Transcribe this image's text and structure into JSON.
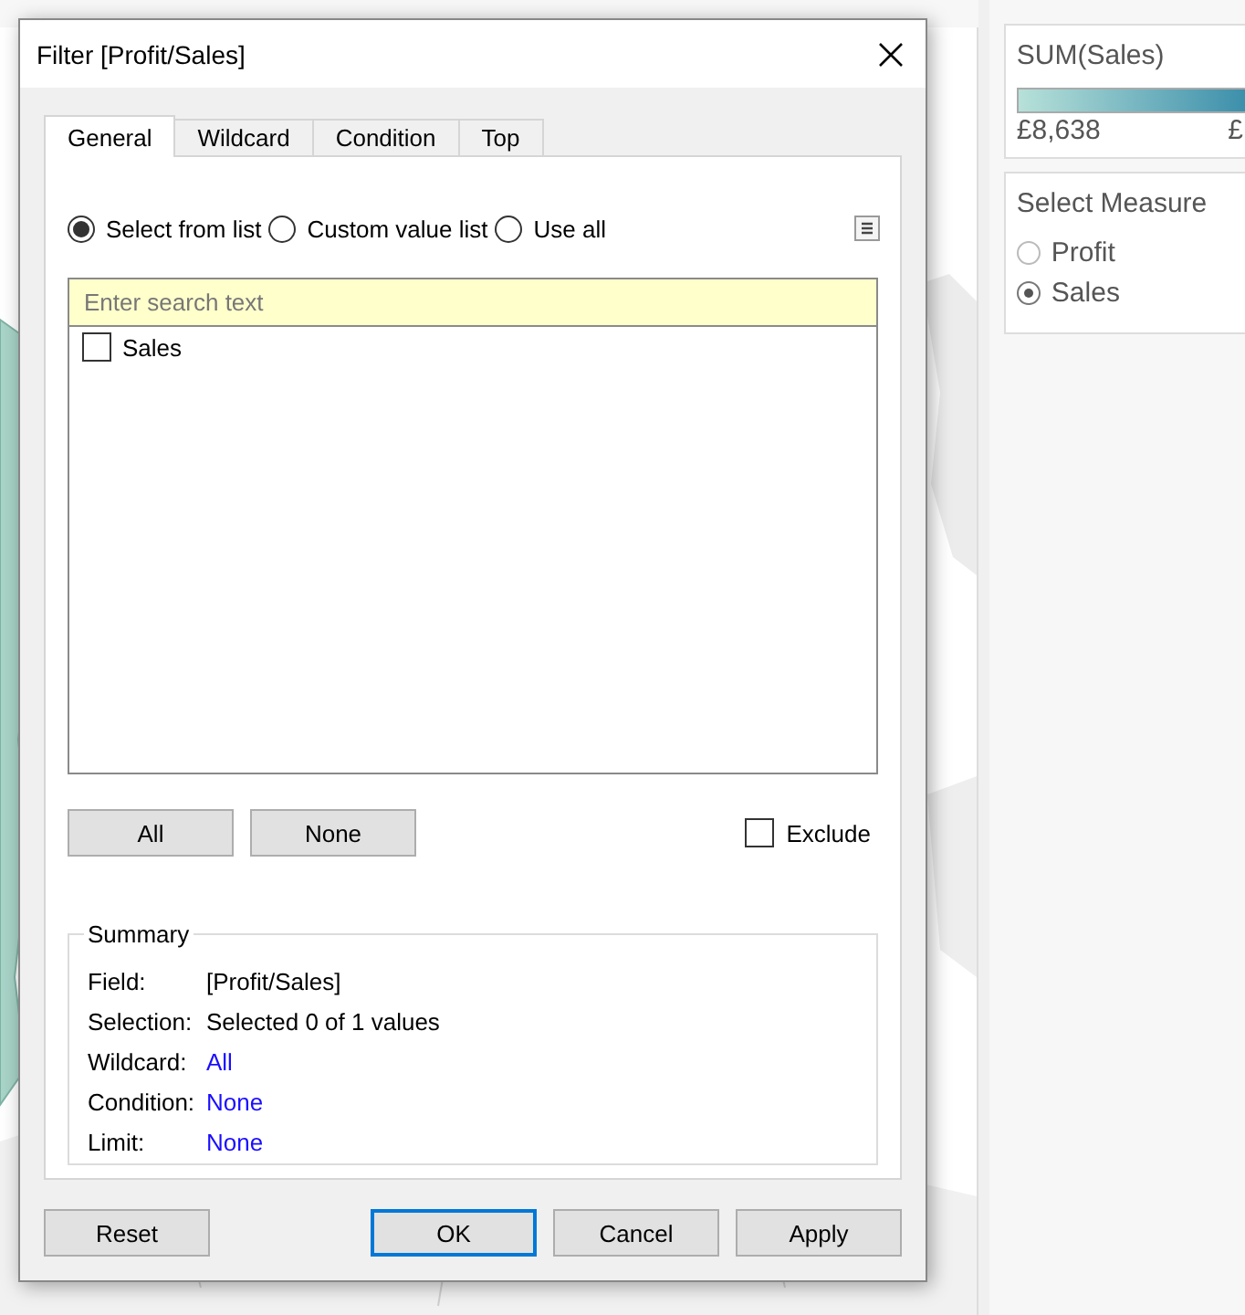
{
  "dialog": {
    "title": "Filter [Profit/Sales]",
    "tabs": [
      {
        "label": "General",
        "selected": true
      },
      {
        "label": "Wildcard",
        "selected": false
      },
      {
        "label": "Condition",
        "selected": false
      },
      {
        "label": "Top",
        "selected": false
      }
    ],
    "modes": [
      {
        "label": "Select from list",
        "selected": true
      },
      {
        "label": "Custom value list",
        "selected": false
      },
      {
        "label": "Use all",
        "selected": false
      }
    ],
    "search": {
      "placeholder": "Enter search text"
    },
    "values": [
      {
        "label": "Sales",
        "checked": false
      }
    ],
    "list_buttons": [
      "All",
      "None"
    ],
    "exclude": {
      "label": "Exclude",
      "checked": false
    },
    "summary": {
      "title": "Summary",
      "rows": [
        {
          "label": "Field:",
          "value": "[Profit/Sales]",
          "kind": "plain"
        },
        {
          "label": "Selection:",
          "value": "Selected 0 of 1 values",
          "kind": "plain"
        },
        {
          "label": "Wildcard:",
          "value": "All",
          "kind": "link"
        },
        {
          "label": "Condition:",
          "value": "None",
          "kind": "link"
        },
        {
          "label": "Limit:",
          "value": "None",
          "kind": "link"
        }
      ]
    },
    "buttons": [
      {
        "label": "Reset",
        "default": false
      },
      {
        "label": "OK",
        "default": true
      },
      {
        "label": "Cancel",
        "default": false
      },
      {
        "label": "Apply",
        "default": false
      }
    ]
  },
  "legend": {
    "title": "SUM(Sales)",
    "min": "£8,638",
    "max": "£"
  },
  "parameter": {
    "title": "Select Measure",
    "options": [
      {
        "label": "Profit",
        "selected": false
      },
      {
        "label": "Sales",
        "selected": true
      }
    ]
  }
}
